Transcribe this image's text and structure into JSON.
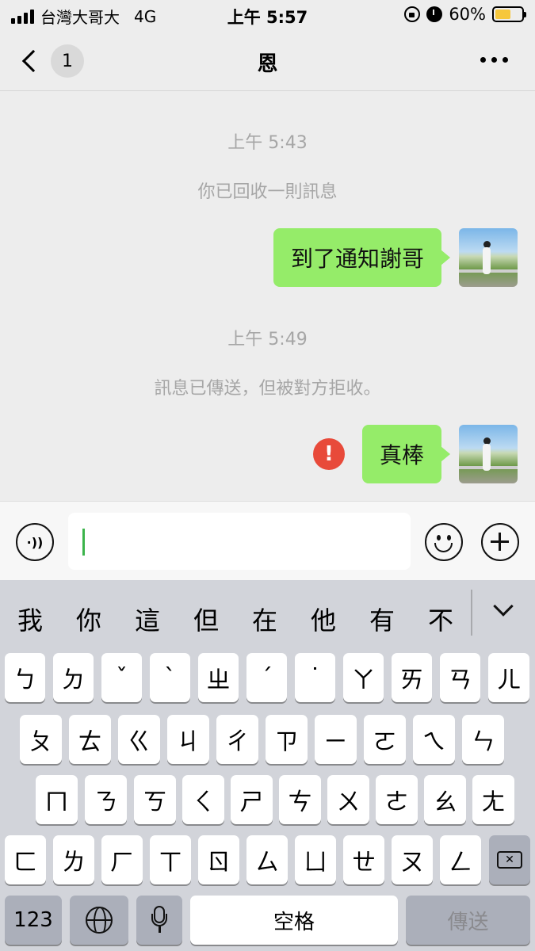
{
  "status_bar": {
    "carrier": "台灣大哥大",
    "network": "4G",
    "time": "上午 5:57",
    "battery": "60%",
    "battery_level": 0.6,
    "battery_color": "#f6c73c"
  },
  "nav": {
    "unread_count": "1",
    "title": "恩",
    "back_icon": "chevron-left-icon",
    "more_icon": "more-icon"
  },
  "chat": {
    "timestamp1": "上午 5:43",
    "recall_notice": "你已回收一則訊息",
    "message1": "到了通知謝哥",
    "timestamp2": "上午 5:49",
    "rejected_notice": "訊息已傳送，但被對方拒收。",
    "message2": "真棒",
    "error_glyph": "!",
    "bubble_color": "#95ec69",
    "error_color": "#e84a3a"
  },
  "input_bar": {
    "value": "",
    "voice_icon": "voice-icon",
    "emoji_icon": "emoji-icon",
    "plus_icon": "plus-icon"
  },
  "keyboard": {
    "suggestions": [
      "我",
      "你",
      "這",
      "但",
      "在",
      "他",
      "有",
      "不"
    ],
    "rows": [
      [
        "ㄅ",
        "ㄉ",
        "ˇ",
        "ˋ",
        "ㄓ",
        "ˊ",
        "˙",
        "ㄚ",
        "ㄞ",
        "ㄢ",
        "ㄦ"
      ],
      [
        "ㄆ",
        "ㄊ",
        "ㄍ",
        "ㄐ",
        "ㄔ",
        "ㄗ",
        "ㄧ",
        "ㄛ",
        "ㄟ",
        "ㄣ"
      ],
      [
        "ㄇ",
        "ㄋ",
        "ㄎ",
        "ㄑ",
        "ㄕ",
        "ㄘ",
        "ㄨ",
        "ㄜ",
        "ㄠ",
        "ㄤ"
      ],
      [
        "ㄈ",
        "ㄌ",
        "ㄏ",
        "ㄒ",
        "ㄖ",
        "ㄙ",
        "ㄩ",
        "ㄝ",
        "ㄡ",
        "ㄥ"
      ]
    ],
    "numbers_key": "123",
    "space_key": "空格",
    "send_key": "傳送",
    "globe_icon": "globe-icon",
    "mic_icon": "microphone-icon",
    "backspace_icon": "backspace-icon"
  }
}
